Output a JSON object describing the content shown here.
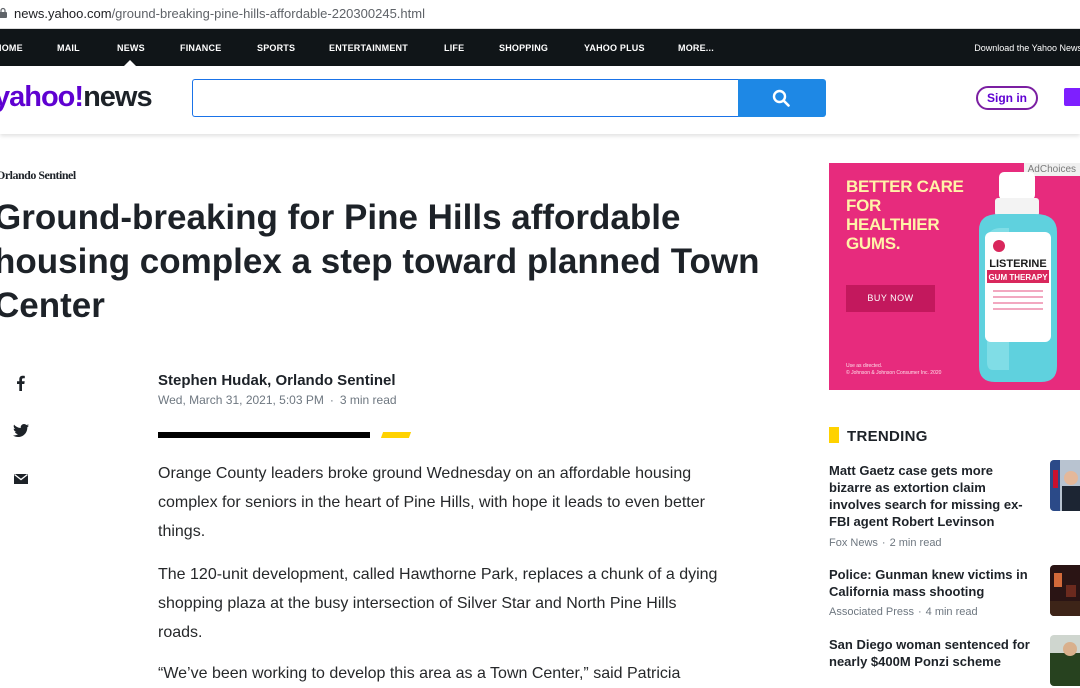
{
  "browser": {
    "url_host": "news.yahoo.com",
    "url_path": "/ground-breaking-pine-hills-affordable-220300245.html"
  },
  "nav": {
    "items": [
      "HOME",
      "MAIL",
      "NEWS",
      "FINANCE",
      "SPORTS",
      "ENTERTAINMENT",
      "LIFE",
      "SHOPPING",
      "YAHOO PLUS",
      "MORE..."
    ],
    "active": "NEWS",
    "download_text": "Download the Yahoo News"
  },
  "header": {
    "logo_brand": "yahoo!",
    "logo_news": "news",
    "search_placeholder": "",
    "signin_label": "Sign in"
  },
  "article": {
    "source": "Orlando Sentinel",
    "title": "Ground-breaking for Pine Hills affordable housing complex a step toward planned Town Center",
    "author": "Stephen Hudak, Orlando Sentinel",
    "date": "Wed, March 31, 2021, 5:03 PM",
    "read_time": "3 min read",
    "paragraphs": [
      "Orange County leaders broke ground Wednesday on an affordable housing complex for seniors in the heart of Pine Hills, with hope it leads to even better things.",
      "The 120-unit development, called Hawthorne Park, replaces a chunk of a dying shopping plaza at the busy intersection of Silver Star and North Pine Hills roads.",
      "“We’ve been working to develop this area as a Town Center,” said Patricia"
    ]
  },
  "share": {
    "icons": [
      "facebook-icon",
      "twitter-icon",
      "mail-icon"
    ]
  },
  "ad": {
    "adchoices": "AdChoices",
    "headline": "BETTER CARE FOR HEALTHIER GUMS.",
    "cta": "BUY NOW",
    "fine_print": [
      "Use as directed.",
      "© Johnson & Johnson Consumer Inc. 2020"
    ],
    "bottle_brand": "LISTERINE",
    "bottle_sub": "GUM THERAPY",
    "colors": {
      "background": "#e72b7d",
      "headline": "#fff3a8",
      "bottle": "#5fd1de"
    }
  },
  "trending": {
    "title": "TRENDING",
    "items": [
      {
        "headline": "Matt Gaetz case gets more bizarre as extortion claim involves search for missing ex-FBI agent Robert Levinson",
        "source": "Fox News",
        "time": "2 min read"
      },
      {
        "headline": "Police: Gunman knew victims in California mass shooting",
        "source": "Associated Press",
        "time": "4 min read"
      },
      {
        "headline": "San Diego woman sentenced for nearly $400M Ponzi scheme",
        "source": "",
        "time": ""
      }
    ]
  },
  "colors": {
    "brand_purple": "#5f01d1",
    "search_blue": "#1e88e5",
    "accent_yellow": "#ffd200",
    "nav_bg": "#101518"
  }
}
